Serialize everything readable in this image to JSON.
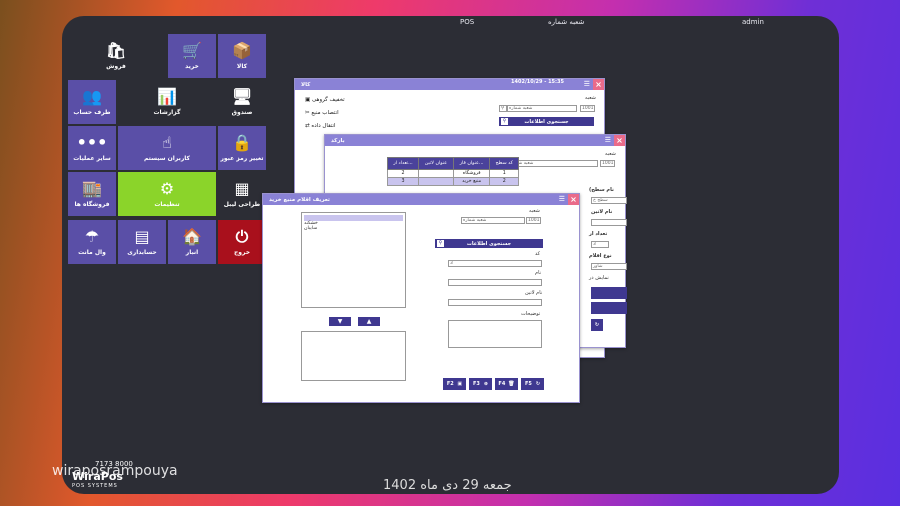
{
  "topbar": {
    "pos": "POS",
    "branch_no": "شعبه شماره",
    "user": "admin"
  },
  "tiles": [
    {
      "name": "sales",
      "label": "فروش",
      "icon": "🛍"
    },
    {
      "name": "purchase",
      "label": "خرید",
      "icon": "🛒"
    },
    {
      "name": "goods",
      "label": "کالا",
      "icon": "📦"
    },
    {
      "name": "accounts",
      "label": "طرف حساب",
      "icon": "👥"
    },
    {
      "name": "reports",
      "label": "گزارشات",
      "icon": "📊"
    },
    {
      "name": "cashbox",
      "label": "صندوق",
      "icon": "🖥"
    },
    {
      "name": "other-ops",
      "label": "سایر عملیات",
      "icon": "•••"
    },
    {
      "name": "system-users",
      "label": "کاربران سیستم",
      "icon": "☝"
    },
    {
      "name": "change-password",
      "label": "تغییر رمز عبور",
      "icon": "🔒"
    },
    {
      "name": "stores",
      "label": "فروشگاه ها",
      "icon": "🏬"
    },
    {
      "name": "settings",
      "label": "تنظیمات",
      "icon": "⚙"
    },
    {
      "name": "label-design",
      "label": "طراحی لیبل",
      "icon": "▦"
    },
    {
      "name": "wall-mount",
      "label": "وال مانت",
      "icon": "☂"
    },
    {
      "name": "accounting",
      "label": "حسابداری",
      "icon": "▤"
    },
    {
      "name": "warehouse",
      "label": "انبار",
      "icon": "🏠"
    },
    {
      "name": "exit",
      "label": "خروج",
      "icon": "⏻"
    }
  ],
  "win_goods": {
    "datetime": "1402/10/29 - 15:35",
    "menu": [
      "تخفیف گروهی",
      "انتصاب منبع",
      "انتقال داده"
    ],
    "branch_label": "شعبه",
    "branch_code": "1001",
    "branch_name": "شعبه شماره",
    "search_btn": "جستجوی اطلاعات"
  },
  "win_barcode": {
    "title": "بارکد",
    "branch_label": "شعبه",
    "branch_code": "1001",
    "branch_name": "شعبه شماره",
    "columns": [
      "کد سطح",
      "عنوان فار...",
      "عنوان لاتین",
      "تعداد ار..."
    ],
    "rows": [
      {
        "code": "1",
        "title": "فروشگاه",
        "latin": "",
        "count": "2"
      },
      {
        "code": "2",
        "title": "منبع خرید",
        "latin": "",
        "count": "3"
      }
    ],
    "side": [
      "(نام سطح",
      "نام لاتین",
      "تعداد ار",
      "نوع اقلام",
      "نمایش در"
    ],
    "side_input": "سطح خ",
    "side_value": "3",
    "side_input2": "شاور"
  },
  "win_items": {
    "title": "تعریف اقلام منبع خرید",
    "branch_label": "شعبه",
    "branch_code": "1001",
    "branch_name": "شعبه شماره",
    "list": [
      "خشکند",
      "سایبان"
    ],
    "search_btn": "جستجوی اطلاعات",
    "code_label": "کد",
    "code_value": "3",
    "name_label": "نام",
    "latin_label": "نام لاتین",
    "desc_label": "توضیحات",
    "buttons": [
      "F2",
      "F3",
      "F4",
      "F5"
    ]
  },
  "footer": {
    "date": "جمعه 29 دی ماه 1402",
    "watermark": "wiraposrampouya",
    "phone": "7173 8000",
    "logo": "WiraPos",
    "logo_sub": "POS SYSTEMS"
  }
}
